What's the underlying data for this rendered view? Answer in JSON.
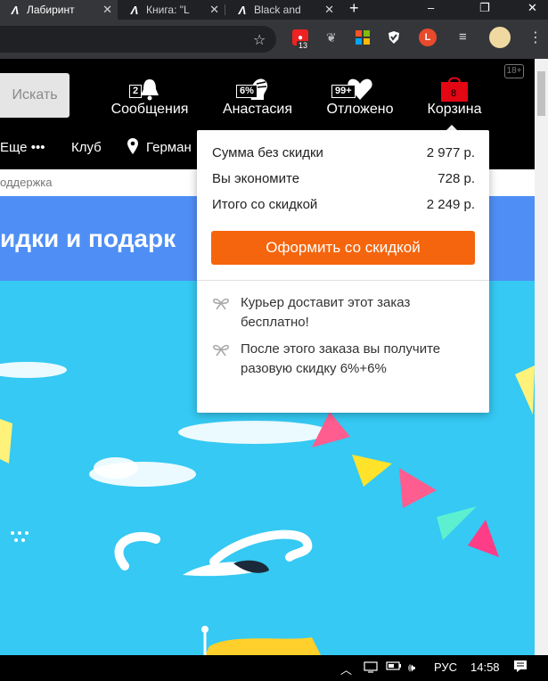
{
  "browser": {
    "tabs": [
      {
        "title": "Лабиринт",
        "active": true
      },
      {
        "title": "Книга: \"L",
        "active": false
      },
      {
        "title": "Black and",
        "active": false
      }
    ],
    "new_tab": "+",
    "window_controls": {
      "minimize": "–",
      "maximize": "❐",
      "close": "✕"
    },
    "extensions": {
      "adblock_count": "13"
    }
  },
  "header": {
    "search_button": "Искать",
    "items": [
      {
        "label": "Сообщения",
        "badge": "2",
        "icon": "bell-icon"
      },
      {
        "label": "Анастасия",
        "badge": "6%",
        "icon": "user-portrait-icon"
      },
      {
        "label": "Отложено",
        "badge": "99+",
        "icon": "heart-icon"
      },
      {
        "label": "Корзина",
        "badge": "8",
        "icon": "cart-bag-icon"
      }
    ],
    "age_rating": "18+"
  },
  "nav": {
    "more": "Еще •••",
    "club": "Клуб",
    "location": "Герман"
  },
  "breadcrumb": "оддержка",
  "banner": {
    "text": "идки и подарк"
  },
  "cart_popup": {
    "rows": [
      {
        "label": "Сумма без скидки",
        "value": "2 977 р."
      },
      {
        "label": "Вы экономите",
        "value": "728 р."
      },
      {
        "label": "Итого со скидкой",
        "value": "2 249 р."
      }
    ],
    "checkout_button": "Оформить со скидкой",
    "notes": [
      "Курьер доставит этот заказ бесплатно!",
      "После этого заказа вы получите разовую скидку 6%+6%"
    ]
  },
  "taskbar": {
    "language": "РУС",
    "time": "14:58"
  },
  "colors": {
    "accent_orange": "#f5650d",
    "cart_red": "#e30613",
    "banner_blue": "#4f8ff5",
    "banner_sky": "#35c9f3"
  }
}
